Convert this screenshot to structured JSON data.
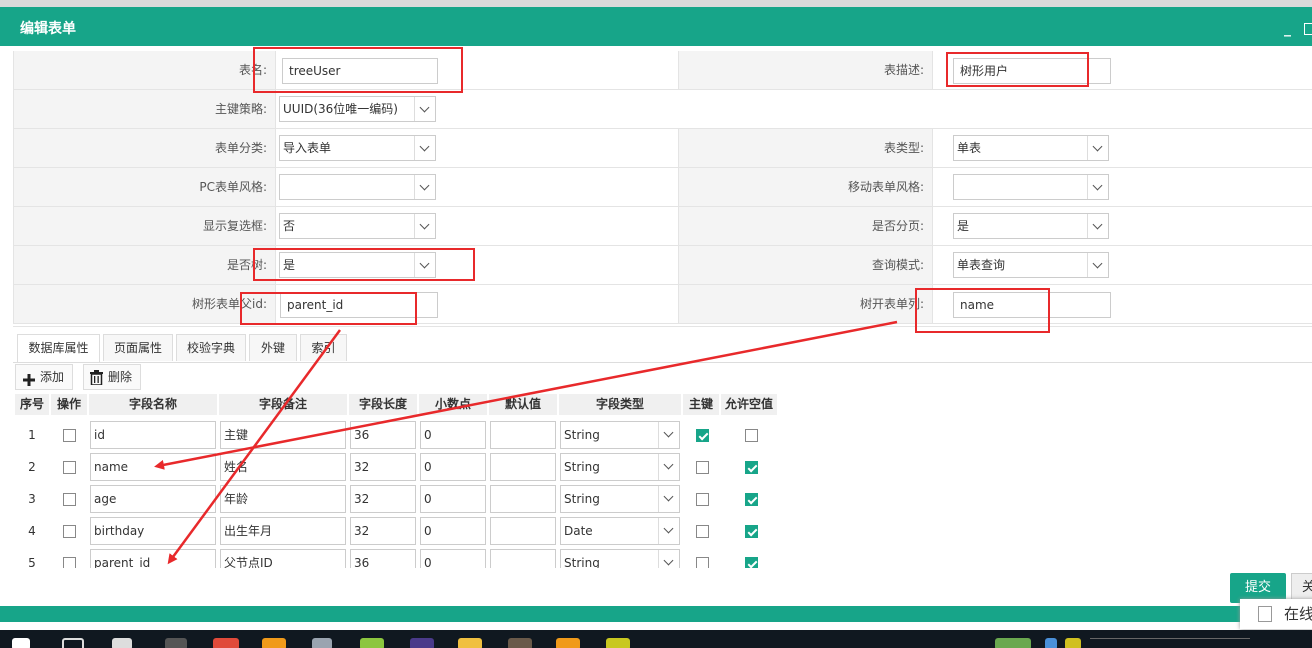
{
  "dialog": {
    "title": "编辑表单",
    "min_glyph": "_"
  },
  "form": {
    "rows": [
      {
        "left_label": "表名:",
        "left_value": "treeUser",
        "left_kind": "input",
        "right_label": "表描述:",
        "right_value": "树形用户",
        "right_kind": "input"
      },
      {
        "left_label": "主键策略:",
        "left_value": "UUID(36位唯一编码)",
        "left_kind": "select"
      },
      {
        "left_label": "表单分类:",
        "left_value": "导入表单",
        "left_kind": "select",
        "right_label": "表类型:",
        "right_value": "单表",
        "right_kind": "select"
      },
      {
        "left_label": "PC表单风格:",
        "left_value": "",
        "left_kind": "select",
        "right_label": "移动表单风格:",
        "right_value": "",
        "right_kind": "select"
      },
      {
        "left_label": "显示复选框:",
        "left_value": "否",
        "left_kind": "select",
        "right_label": "是否分页:",
        "right_value": "是",
        "right_kind": "select"
      },
      {
        "left_label": "是否树:",
        "left_value": "是",
        "left_kind": "select",
        "right_label": "查询模式:",
        "right_value": "单表查询",
        "right_kind": "select"
      },
      {
        "left_label": "树形表单父id:",
        "left_value": "parent_id",
        "left_kind": "input",
        "right_label": "树开表单列:",
        "right_value": "name",
        "right_kind": "input"
      }
    ]
  },
  "tabs": [
    "数据库属性",
    "页面属性",
    "校验字典",
    "外键",
    "索引"
  ],
  "toolbar": {
    "add_label": "添加",
    "delete_label": "删除"
  },
  "grid": {
    "headers": [
      "序号",
      "操作",
      "字段名称",
      "字段备注",
      "字段长度",
      "小数点",
      "默认值",
      "字段类型",
      "主键",
      "允许空值"
    ],
    "rows": [
      {
        "num": "1",
        "name": "id",
        "remark": "主键",
        "length": "36",
        "decimal": "0",
        "default": "",
        "type": "String",
        "pk": true,
        "nullable": false
      },
      {
        "num": "2",
        "name": "name",
        "remark": "姓名",
        "length": "32",
        "decimal": "0",
        "default": "",
        "type": "String",
        "pk": false,
        "nullable": true
      },
      {
        "num": "3",
        "name": "age",
        "remark": "年龄",
        "length": "32",
        "decimal": "0",
        "default": "",
        "type": "String",
        "pk": false,
        "nullable": true
      },
      {
        "num": "4",
        "name": "birthday",
        "remark": "出生年月",
        "length": "32",
        "decimal": "0",
        "default": "",
        "type": "Date",
        "pk": false,
        "nullable": true
      },
      {
        "num": "5",
        "name": "parent_id",
        "remark": "父节点ID",
        "length": "36",
        "decimal": "0",
        "default": "",
        "type": "String",
        "pk": false,
        "nullable": true
      }
    ]
  },
  "footer": {
    "submit_label": "提交",
    "close_label": "关",
    "online_label": "在线"
  },
  "colors": {
    "accent": "#17a589",
    "annotation_red": "#e8292b"
  }
}
